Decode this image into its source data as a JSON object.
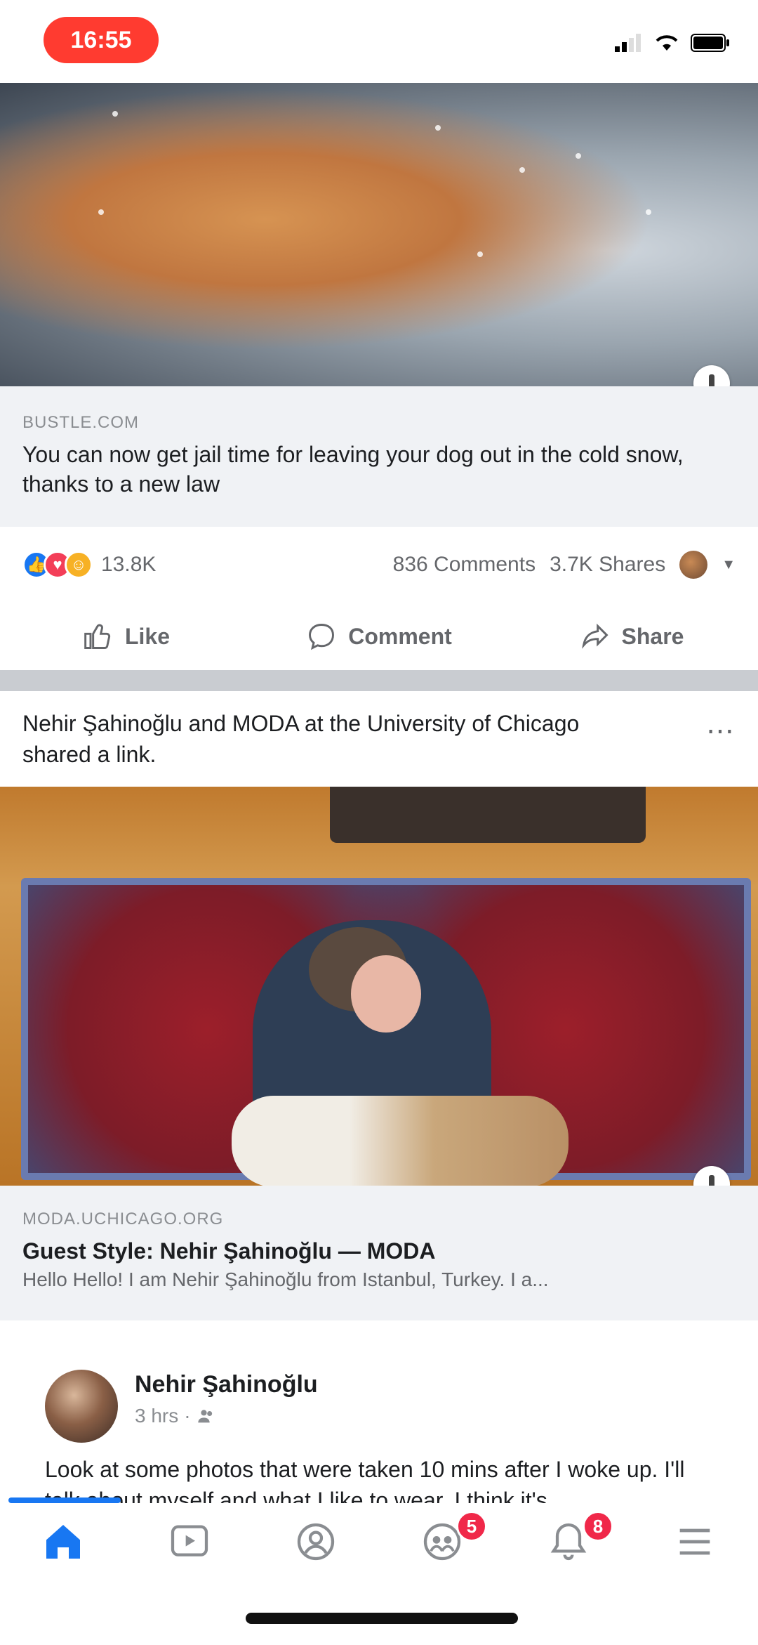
{
  "status_bar": {
    "time": "16:55",
    "icons": [
      "signal-icon",
      "wifi-icon",
      "battery-icon"
    ]
  },
  "post1": {
    "link": {
      "source": "BUSTLE.COM",
      "title": "You can now get jail time for leaving your dog out in the cold snow, thanks to a new law"
    },
    "reactions": {
      "count": "13.8K",
      "types": [
        "like",
        "love",
        "haha"
      ]
    },
    "stats": {
      "comments": "836 Comments",
      "shares": "3.7K Shares"
    },
    "actions": {
      "like": "Like",
      "comment": "Comment",
      "share": "Share"
    }
  },
  "post2": {
    "header_text": "Nehir Şahinoğlu and MODA at the University of Chicago shared a link.",
    "link": {
      "source": "MODA.UCHICAGO.ORG",
      "title": "Guest Style: Nehir Şahinoğlu — MODA",
      "description": "Hello Hello! I am Nehir Şahinoğlu from Istanbul, Turkey. I a..."
    }
  },
  "post3": {
    "author": "Nehir Şahinoğlu",
    "time": "3 hrs",
    "text": "Look at some photos that were taken 10 mins after I woke up. I'll talk about myself and what I like to wear. I think it's..."
  },
  "tabbar": {
    "badges": {
      "groups": "5",
      "notifications": "8"
    }
  },
  "colors": {
    "accent": "#1877f2",
    "badge": "#f02849",
    "status_pill": "#ff3b30"
  }
}
